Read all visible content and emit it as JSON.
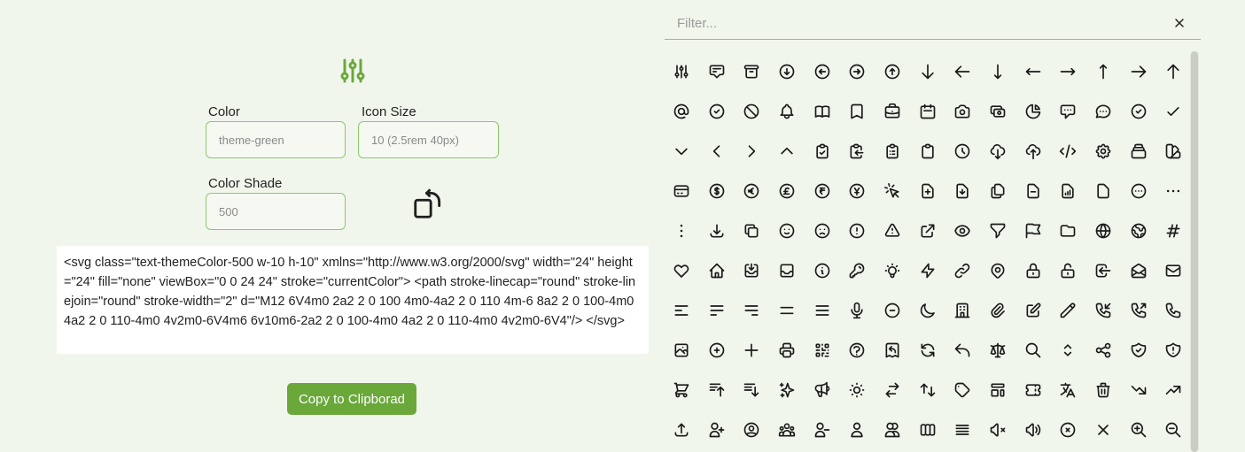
{
  "editor": {
    "color_label": "Color",
    "color_placeholder": "theme-green",
    "size_label": "Icon Size",
    "size_placeholder": "10 (2.5rem 40px)",
    "shade_label": "Color Shade",
    "shade_placeholder": "500",
    "code": "<svg class=\"text-themeColor-500 w-10 h-10\" xmlns=\"http://www.w3.org/2000/svg\" width=\"24\" height=\"24\" fill=\"none\" viewBox=\"0 0 24 24\" stroke=\"currentColor\"> <path stroke-linecap=\"round\" stroke-linejoin=\"round\" stroke-width=\"2\" d=\"M12 6V4m0 2a2 2 0 100 4m0-4a2 2 0 110 4m-6 8a2 2 0 100-4m0 4a2 2 0 110-4m0 4v2m0-6V4m6 6v10m6-2a2 2 0 100-4m0 4a2 2 0 110-4m0 4v2m0-6V4\"/> </svg>",
    "copy_label": "Copy to Clipborad",
    "accent_color": "#6aa83a"
  },
  "filter": {
    "placeholder": "Filter..."
  },
  "icons": [
    "adjustments",
    "annotation",
    "archive",
    "arrow-circle-down",
    "arrow-circle-left",
    "arrow-circle-right",
    "arrow-circle-up",
    "arrow-down",
    "arrow-left",
    "arrow-narrow-down",
    "arrow-narrow-left",
    "arrow-narrow-right",
    "arrow-narrow-up",
    "arrow-right",
    "arrow-up",
    "at-symbol",
    "badge-check",
    "ban",
    "bell",
    "book-open",
    "bookmark",
    "briefcase",
    "calendar",
    "camera",
    "cash",
    "chart-pie",
    "chat-alt",
    "chat",
    "check-circle",
    "check",
    "chevron-down",
    "chevron-left",
    "chevron-right",
    "chevron-up",
    "clipboard-check",
    "clipboard-copy",
    "clipboard-list",
    "clipboard",
    "clock",
    "cloud-download",
    "cloud-upload",
    "code",
    "cog",
    "collection",
    "color-swatch",
    "credit-card",
    "currency-dollar",
    "currency-euro",
    "currency-pound",
    "currency-rupee",
    "currency-yen",
    "cursor-click",
    "document-add",
    "document-download",
    "document-duplicate",
    "document-remove",
    "document-report",
    "document",
    "dots-circle-horizontal",
    "dots-horizontal",
    "dots-vertical",
    "download",
    "duplicate",
    "emoji-happy",
    "emoji-sad",
    "exclamation-circle",
    "exclamation",
    "external-link",
    "eye",
    "filter",
    "flag",
    "folder",
    "globe",
    "globe-alt",
    "hashtag",
    "heart",
    "home",
    "inbox-in",
    "inbox",
    "information-circle",
    "key",
    "light-bulb",
    "lightning-bolt",
    "link",
    "location-marker",
    "lock-closed",
    "lock-open",
    "login",
    "mail-open",
    "mail",
    "menu-alt-1",
    "menu-alt-2",
    "menu-alt-3",
    "menu-alt-4",
    "menu",
    "microphone",
    "minus-circle",
    "moon",
    "office-building",
    "paper-clip",
    "pencil-alt",
    "pencil",
    "phone-incoming",
    "phone-outgoing",
    "phone",
    "photograph",
    "plus-circle",
    "plus",
    "printer",
    "qrcode",
    "question-mark-circle",
    "receipt-refund",
    "refresh",
    "reply",
    "scale",
    "search",
    "selector",
    "share",
    "shield-check",
    "shield-exclamation",
    "shopping-cart",
    "sort-ascending",
    "sort-descending",
    "sparkles",
    "speakerphone",
    "sun",
    "switch-horizontal",
    "switch-vertical",
    "tag",
    "template",
    "ticket",
    "translate",
    "trash",
    "trending-down",
    "trending-up",
    "upload",
    "user-add",
    "user-circle",
    "user-group",
    "user-remove",
    "user",
    "users",
    "view-boards",
    "view-list",
    "volume-off",
    "volume-up",
    "x-circle",
    "x",
    "zoom-in",
    "zoom-out"
  ]
}
